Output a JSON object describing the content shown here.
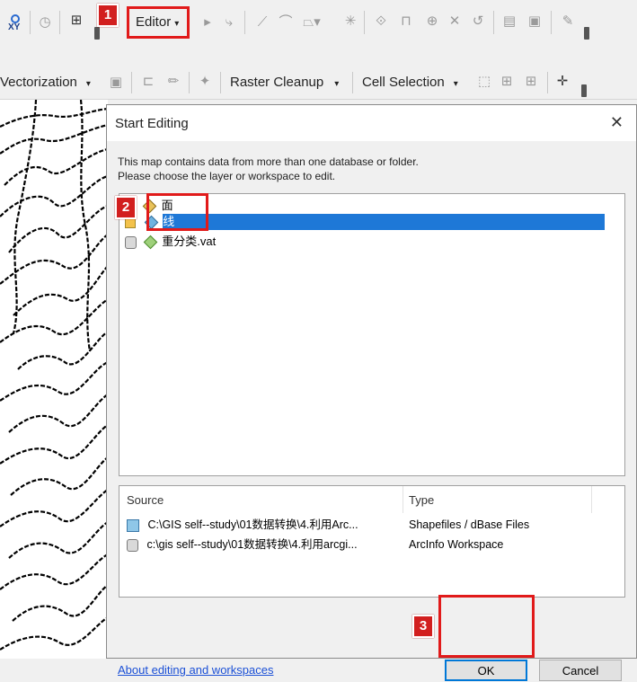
{
  "toolbar_top": {
    "editor_menu_label": "Editor",
    "xy_label": "XY"
  },
  "toolbar_second": {
    "vectorization_label": "Vectorization",
    "raster_cleanup_label": "Raster Cleanup",
    "cell_selection_label": "Cell Selection"
  },
  "callouts": {
    "step1": "1",
    "step2": "2",
    "step3": "3"
  },
  "dialog": {
    "title": "Start Editing",
    "message_line1": "This map contains data from more than one database or folder.",
    "message_line2": "Please choose the layer or workspace to edit.",
    "layers": [
      {
        "label": "面"
      },
      {
        "label": "线",
        "selected": true
      },
      {
        "label": "重分类.vat"
      }
    ],
    "source_table": {
      "headers": {
        "source": "Source",
        "type": "Type"
      },
      "rows": [
        {
          "source": "C:\\GIS  self--study\\01数据转换\\4.利用Arc...",
          "type": "Shapefiles / dBase Files"
        },
        {
          "source": "c:\\gis  self--study\\01数据转换\\4.利用arcgi...",
          "type": "ArcInfo Workspace"
        }
      ]
    },
    "help_link": "About editing and workspaces",
    "ok_label": "OK",
    "cancel_label": "Cancel"
  },
  "colors": {
    "callout_red": "#d21e1e",
    "selection_blue": "#1e78d7",
    "link_blue": "#1a4fd6"
  }
}
